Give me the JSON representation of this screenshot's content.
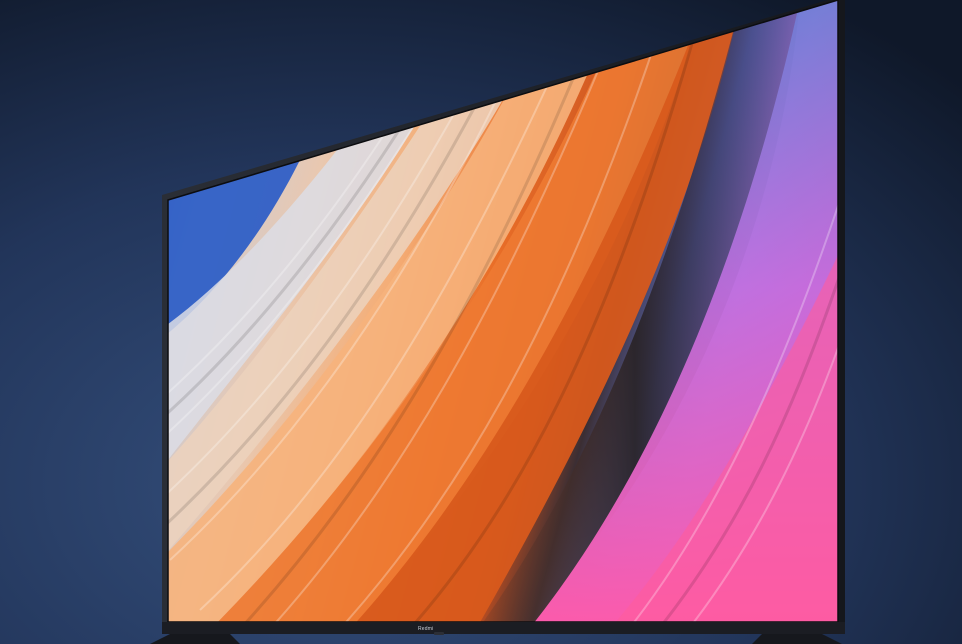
{
  "scene": {
    "subject": "tv-product-photo",
    "colors": {
      "background_top": "#0f1829",
      "background_bottom": "#2d4670",
      "bezel": "#1e2128",
      "stand": "#16181d"
    }
  },
  "tv": {
    "brand_label": "Redmi",
    "screen_palette": [
      "#2f5fc6",
      "#d9dbe2",
      "#f4b889",
      "#ef7b2f",
      "#d8541a",
      "#3a2f35",
      "#4f6bc9",
      "#a873d6",
      "#ee4fb5",
      "#ff6f7a"
    ]
  }
}
